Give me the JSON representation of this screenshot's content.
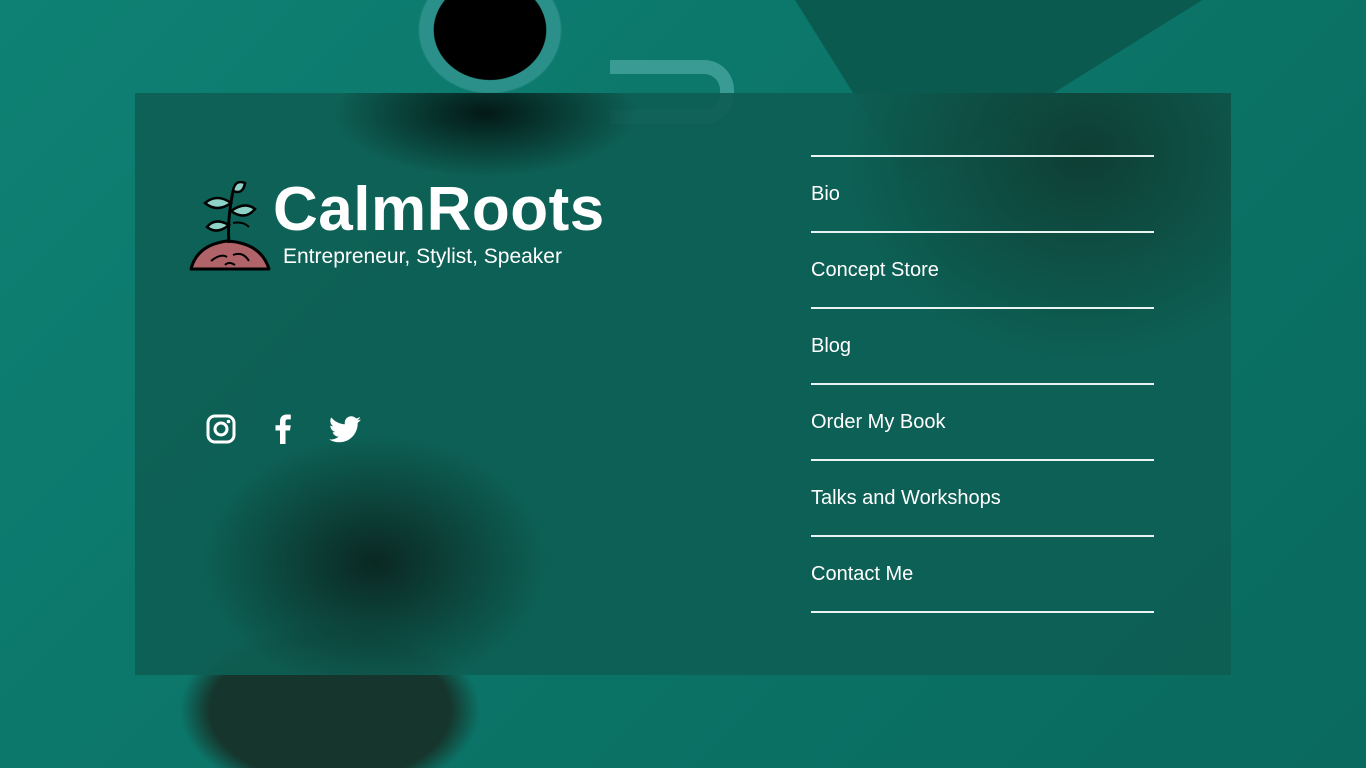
{
  "brand": {
    "name": "CalmRoots",
    "tagline": "Entrepreneur, Stylist, Speaker",
    "logo_icon": "sprout-icon"
  },
  "socials": [
    {
      "icon": "instagram-icon"
    },
    {
      "icon": "facebook-icon"
    },
    {
      "icon": "twitter-icon"
    }
  ],
  "nav": {
    "items": [
      {
        "label": "Bio"
      },
      {
        "label": "Concept Store"
      },
      {
        "label": "Blog"
      },
      {
        "label": "Order My Book"
      },
      {
        "label": "Talks and Workshops"
      },
      {
        "label": "Contact Me"
      }
    ]
  },
  "colors": {
    "background": "#0f7a6e",
    "card": "#0e5e54",
    "text": "#ffffff",
    "soil": "#b0646a",
    "leaf": "#8fd3c8"
  }
}
